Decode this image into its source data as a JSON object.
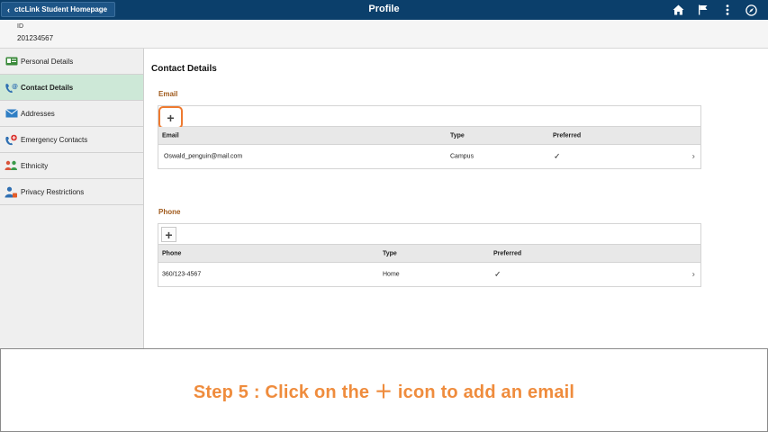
{
  "header": {
    "back_label": "ctcLink Student Homepage",
    "title": "Profile",
    "icons": [
      "home-icon",
      "flag-icon",
      "more-vertical-icon",
      "compass-icon"
    ]
  },
  "identity": {
    "id_label": "ID",
    "id_value": "201234567"
  },
  "sidebar": {
    "items": [
      {
        "label": "Personal Details",
        "icon": "id-card-icon",
        "active": false
      },
      {
        "label": "Contact Details",
        "icon": "phone-at-icon",
        "active": true
      },
      {
        "label": "Addresses",
        "icon": "envelope-icon",
        "active": false
      },
      {
        "label": "Emergency Contacts",
        "icon": "emergency-phone-icon",
        "active": false
      },
      {
        "label": "Ethnicity",
        "icon": "people-icon",
        "active": false
      },
      {
        "label": "Privacy Restrictions",
        "icon": "user-lock-icon",
        "active": false
      }
    ]
  },
  "main": {
    "title": "Contact Details",
    "email": {
      "section_label": "Email",
      "add_symbol": "+",
      "columns": [
        "Email",
        "Type",
        "Preferred"
      ],
      "rows": [
        {
          "email": "Oswald_penguin@mail.com",
          "type": "Campus",
          "preferred": "✓"
        }
      ]
    },
    "phone": {
      "section_label": "Phone",
      "add_symbol": "+",
      "columns": [
        "Phone",
        "Type",
        "Preferred"
      ],
      "rows": [
        {
          "phone": "360/123-4567",
          "type": "Home",
          "preferred": "✓"
        }
      ]
    }
  },
  "instruction": {
    "text": "Step 5 : Click on the ＋ icon to add an email"
  },
  "colors": {
    "header_bg": "#0b3f6b",
    "active_nav": "#cde8d7",
    "section_label": "#a05a1c",
    "highlight": "#ee7a30",
    "instruction_text": "#ef8c3d"
  }
}
